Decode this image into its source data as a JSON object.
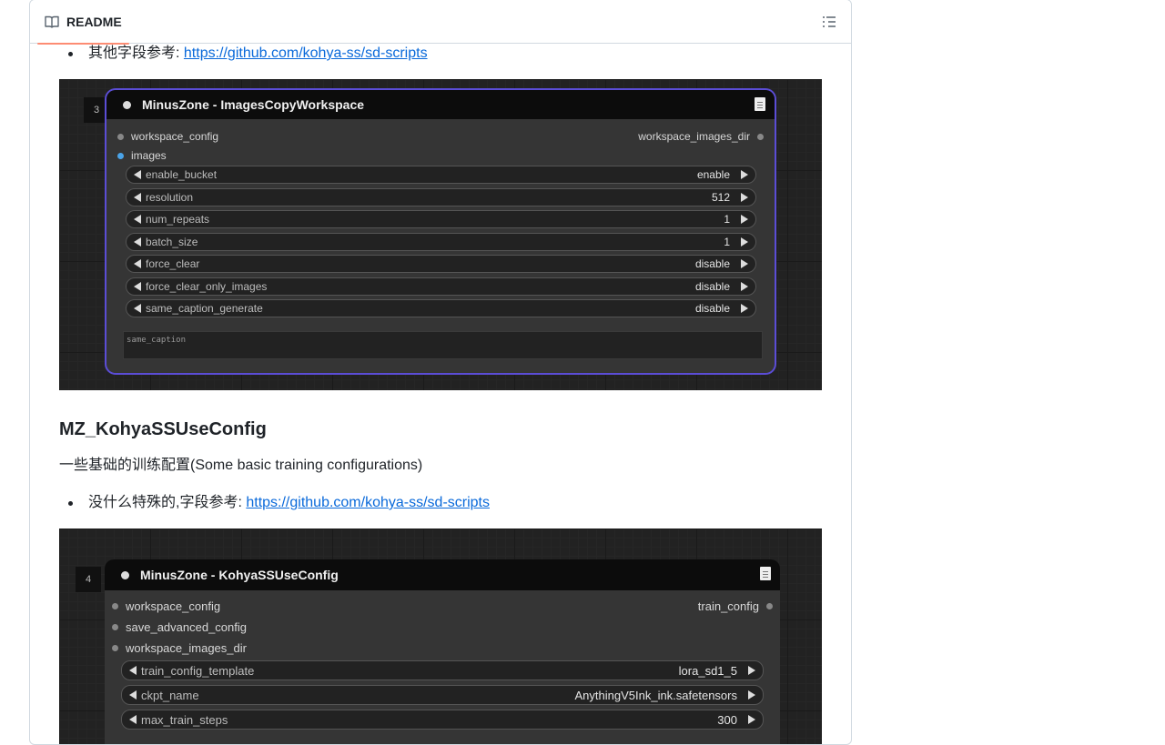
{
  "header": {
    "tab_label": "README",
    "book_icon": "book-icon",
    "outline_icon": "list-outline-icon"
  },
  "section1": {
    "bullet_text": "其他字段参考: ",
    "bullet_link": "https://github.com/kohya-ss/sd-scripts",
    "node": {
      "id": "3",
      "title": "MinusZone - ImagesCopyWorkspace",
      "inputs": [
        "workspace_config",
        "images"
      ],
      "output": "workspace_images_dir",
      "widgets": [
        {
          "label": "enable_bucket",
          "value": "enable"
        },
        {
          "label": "resolution",
          "value": "512"
        },
        {
          "label": "num_repeats",
          "value": "1"
        },
        {
          "label": "batch_size",
          "value": "1"
        },
        {
          "label": "force_clear",
          "value": "disable"
        },
        {
          "label": "force_clear_only_images",
          "value": "disable"
        },
        {
          "label": "same_caption_generate",
          "value": "disable"
        }
      ],
      "textarea_placeholder": "same_caption"
    }
  },
  "section2": {
    "heading": "MZ_KohyaSSUseConfig",
    "description": "一些基础的训练配置(Some basic training configurations)",
    "bullet_text": "没什么特殊的,字段参考: ",
    "bullet_link": "https://github.com/kohya-ss/sd-scripts",
    "node": {
      "id": "4",
      "title": "MinusZone - KohyaSSUseConfig",
      "inputs": [
        "workspace_config",
        "save_advanced_config",
        "workspace_images_dir"
      ],
      "output": "train_config",
      "widgets": [
        {
          "label": "train_config_template",
          "value": "lora_sd1_5"
        },
        {
          "label": "ckpt_name",
          "value": "AnythingV5Ink_ink.safetensors"
        },
        {
          "label": "max_train_steps",
          "value": "300"
        }
      ]
    }
  },
  "colors": {
    "link": "#0969da",
    "tab_underline": "#fd8c73",
    "node_selected_outline": "#5b4dd6"
  }
}
